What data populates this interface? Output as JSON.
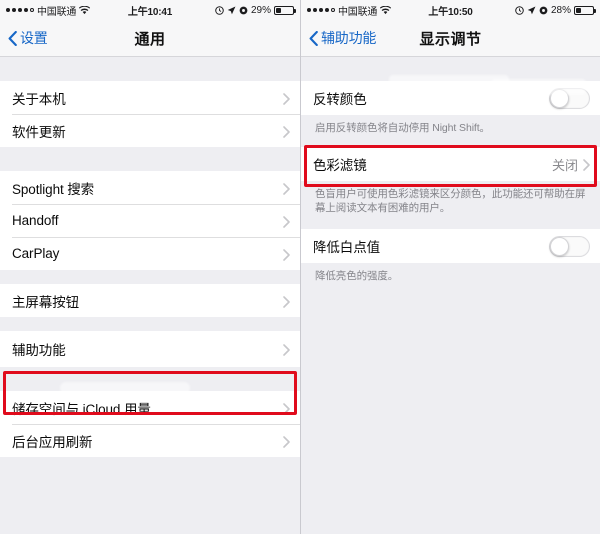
{
  "left_phone": {
    "status_bar": {
      "signal_dots_filled": 4,
      "signal_dots_total": 5,
      "carrier": "中国联通",
      "wifi_icon": "wifi-icon",
      "time": "上午10:41",
      "alarm_icon": "alarm-icon",
      "location_icon": "location-arrow-icon",
      "rotation_lock_icon": "rotation-lock-icon",
      "battery_percent": "29%",
      "battery_level": 29
    },
    "nav": {
      "back_icon": "chevron-left-icon",
      "back_label": "设置",
      "title": "通用"
    },
    "groups": [
      {
        "rows": [
          {
            "label": "关于本机",
            "accessory": "chevron-right-icon"
          },
          {
            "label": "软件更新",
            "accessory": "chevron-right-icon"
          }
        ]
      },
      {
        "rows": [
          {
            "label": "Spotlight 搜索",
            "accessory": "chevron-right-icon"
          },
          {
            "label": "Handoff",
            "accessory": "chevron-right-icon"
          },
          {
            "label": "CarPlay",
            "accessory": "chevron-right-icon"
          }
        ]
      },
      {
        "rows": [
          {
            "label": "主屏幕按钮",
            "accessory": "chevron-right-icon"
          }
        ]
      },
      {
        "highlighted": true,
        "rows": [
          {
            "label": "辅助功能",
            "accessory": "chevron-right-icon"
          }
        ]
      },
      {
        "rows": [
          {
            "label": "储存空间与 iCloud 用量",
            "accessory": "chevron-right-icon"
          },
          {
            "label": "后台应用刷新",
            "accessory": "chevron-right-icon"
          }
        ]
      }
    ]
  },
  "right_phone": {
    "status_bar": {
      "signal_dots_filled": 4,
      "signal_dots_total": 5,
      "carrier": "中国联通",
      "wifi_icon": "wifi-icon",
      "time": "上午10:50",
      "alarm_icon": "alarm-icon",
      "location_icon": "location-arrow-icon",
      "rotation_lock_icon": "rotation-lock-icon",
      "battery_percent": "28%",
      "battery_level": 28
    },
    "nav": {
      "back_icon": "chevron-left-icon",
      "back_label": "辅助功能",
      "title": "显示调节"
    },
    "rows": {
      "invert_colors": {
        "label": "反转颜色",
        "toggle_state": "off"
      },
      "invert_colors_footnote": "启用反转颜色将自动停用 Night Shift。",
      "color_filters": {
        "label": "色彩滤镜",
        "value": "关闭",
        "accessory": "chevron-right-icon",
        "highlighted": true
      },
      "color_filters_footnote": "色盲用户可使用色彩滤镜来区分颜色，此功能还可帮助在屏幕上阅读文本有困难的用户。",
      "reduce_white_point": {
        "label": "降低白点值",
        "toggle_state": "off"
      },
      "reduce_white_point_footnote": "降低亮色的强度。"
    }
  },
  "annotation": {
    "color": "#e00b1c"
  }
}
